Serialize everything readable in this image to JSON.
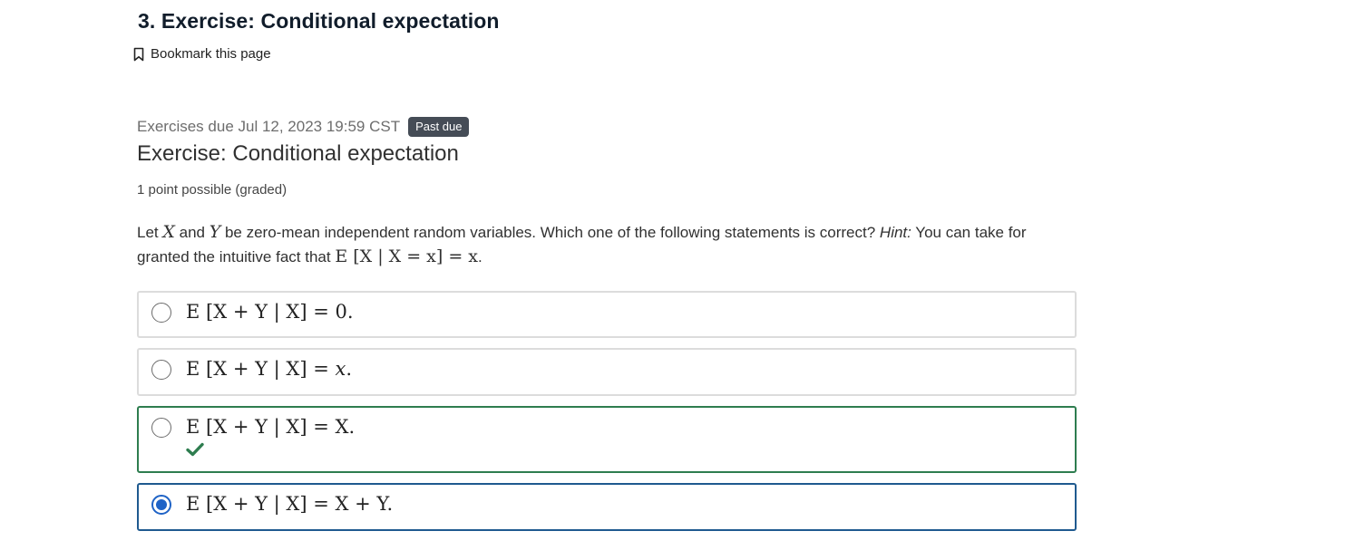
{
  "page": {
    "title": "3. Exercise: Conditional expectation",
    "bookmark_label": "Bookmark this page"
  },
  "due": {
    "text": "Exercises due Jul 12, 2023 19:59 CST",
    "badge": "Past due"
  },
  "problem": {
    "title": "Exercise: Conditional expectation",
    "points": "1 point possible (graded)",
    "prompt": {
      "part1": "Let ",
      "var_x": "X",
      "part2": " and ",
      "var_y": "Y",
      "part3": " be zero-mean independent random variables. Which one of the following statements is correct? ",
      "hint_label": "Hint:",
      "part4": " You can take for granted the intuitive fact that ",
      "formula": "E [X | X = x] = x",
      "part5": "."
    },
    "choices": [
      {
        "lhs": "E [X + Y | X] = ",
        "rhs": "0",
        "end": ".",
        "selected": false,
        "marked_correct": false
      },
      {
        "lhs": "E [X + Y | X] = ",
        "rhs": "x",
        "end": ".",
        "selected": false,
        "marked_correct": false
      },
      {
        "lhs": "E [X + Y | X] = ",
        "rhs": "X",
        "end": ".",
        "selected": false,
        "marked_correct": true
      },
      {
        "lhs": "E [X + Y | X] = ",
        "rhs": "X + Y",
        "end": ".",
        "selected": true,
        "marked_correct": false
      }
    ]
  },
  "colors": {
    "correct_border": "#2e7d4f",
    "selected_border": "#1f5a8f",
    "radio_checked": "#1f63c6",
    "badge_bg": "#454c56"
  },
  "icons": {
    "bookmark": "bookmark-icon",
    "check": "checkmark-icon"
  }
}
